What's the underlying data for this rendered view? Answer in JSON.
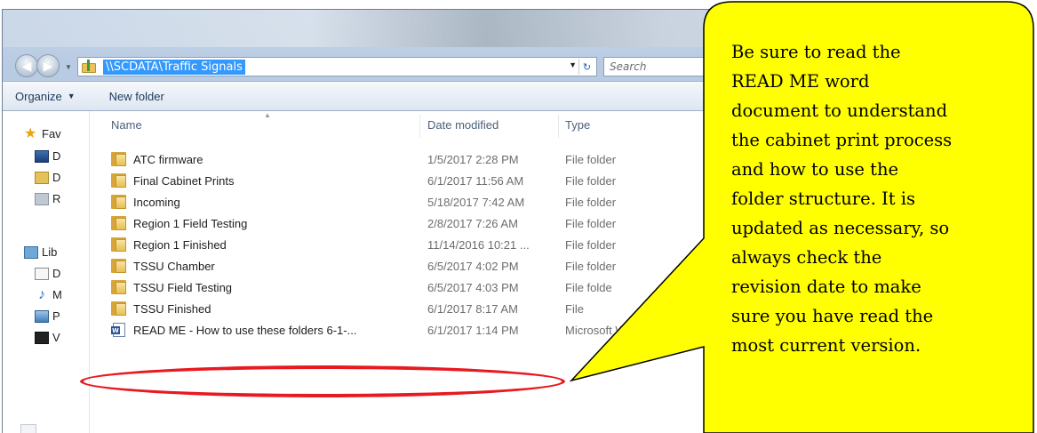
{
  "window": {
    "address_path": "\\\\SCDATA\\Traffic Signals",
    "search_placeholder": "Search"
  },
  "toolbar": {
    "organize_label": "Organize",
    "new_folder_label": "New folder"
  },
  "nav_pane": {
    "items": [
      {
        "label": "Fav",
        "icon": "star-icon"
      },
      {
        "label": "D",
        "icon": "desktop-icon"
      },
      {
        "label": "D",
        "icon": "downloads-icon"
      },
      {
        "label": "R",
        "icon": "recent-places-icon"
      },
      {
        "label": "Lib",
        "icon": "libraries-icon"
      },
      {
        "label": "D",
        "icon": "documents-icon"
      },
      {
        "label": "M",
        "icon": "music-icon"
      },
      {
        "label": "P",
        "icon": "pictures-icon"
      },
      {
        "label": "V",
        "icon": "videos-icon"
      }
    ]
  },
  "columns": {
    "name": "Name",
    "date_modified": "Date modified",
    "type": "Type"
  },
  "files": [
    {
      "name": "ATC firmware",
      "date": "1/5/2017 2:28 PM",
      "type": "File folder",
      "icon": "folder-icon"
    },
    {
      "name": "Final Cabinet Prints",
      "date": "6/1/2017 11:56 AM",
      "type": "File folder",
      "icon": "folder-icon"
    },
    {
      "name": "Incoming",
      "date": "5/18/2017 7:42 AM",
      "type": "File folder",
      "icon": "folder-icon"
    },
    {
      "name": "Region 1 Field Testing",
      "date": "2/8/2017 7:26 AM",
      "type": "File folder",
      "icon": "folder-icon"
    },
    {
      "name": "Region 1 Finished",
      "date": "11/14/2016 10:21 ...",
      "type": "File folder",
      "icon": "folder-icon"
    },
    {
      "name": "TSSU Chamber",
      "date": "6/5/2017 4:02 PM",
      "type": "File folder",
      "icon": "folder-icon"
    },
    {
      "name": "TSSU Field Testing",
      "date": "6/5/2017 4:03 PM",
      "type": "File folde",
      "icon": "folder-icon"
    },
    {
      "name": "TSSU Finished",
      "date": "6/1/2017 8:17 AM",
      "type": "File",
      "icon": "folder-icon"
    },
    {
      "name": "READ ME - How to use these folders 6-1-...",
      "date": "6/1/2017 1:14 PM",
      "type": "Microsoft Word D...",
      "icon": "word-document-icon"
    }
  ],
  "callout": {
    "lines": [
      "Be sure to read the",
      "READ ME word",
      "document to understand",
      "the cabinet print process",
      "and how to use the",
      "folder structure. It is",
      "updated as necessary, so",
      "always check the",
      "revision date to make",
      "sure you have read the",
      "most current version."
    ]
  },
  "colors": {
    "callout_fill": "#ffff00",
    "highlight_oval": "#e8191f",
    "address_selection": "#3399ff"
  }
}
